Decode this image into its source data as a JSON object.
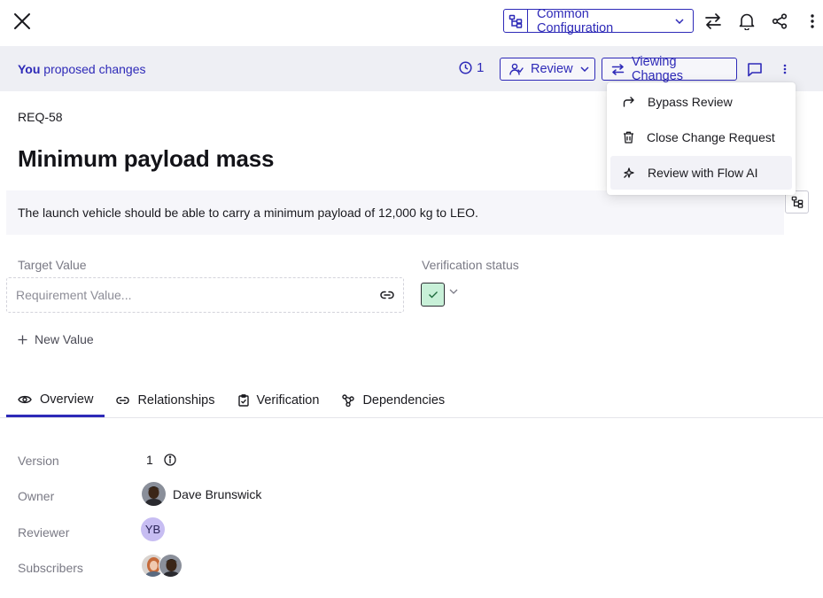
{
  "header": {
    "configuration": "Common Configuration"
  },
  "proposal": {
    "actor": "You",
    "text": "proposed changes",
    "history_count": "1",
    "review_label": "Review",
    "viewing_changes_label": "Viewing Changes"
  },
  "menu": {
    "items": [
      {
        "label": "Bypass Review",
        "icon": "redirect-arrow-icon"
      },
      {
        "label": "Close Change Request",
        "icon": "trash-icon"
      },
      {
        "label": "Review with Flow AI",
        "icon": "sparkle-icon"
      }
    ]
  },
  "requirement": {
    "id": "REQ-58",
    "title": "Minimum payload mass",
    "description": "The launch vehicle should be able to carry a minimum payload of 12,000 kg to LEO."
  },
  "fields": {
    "target_value_label": "Target Value",
    "value_placeholder": "Requirement Value...",
    "verification_label": "Verification status",
    "new_value_label": "New Value"
  },
  "tabs": [
    {
      "label": "Overview",
      "active": true
    },
    {
      "label": "Relationships"
    },
    {
      "label": "Verification"
    },
    {
      "label": "Dependencies"
    }
  ],
  "overview": {
    "version_label": "Version",
    "version": "1",
    "owner_label": "Owner",
    "owner": "Dave Brunswick",
    "reviewer_label": "Reviewer",
    "reviewer_initials": "YB",
    "subscribers_label": "Subscribers"
  },
  "colors": {
    "accent": "#2e2ab8",
    "banner_bg": "#eeeff4",
    "status_green": "#c8f0d8",
    "reviewer_avatar": "#c7bdf2"
  }
}
